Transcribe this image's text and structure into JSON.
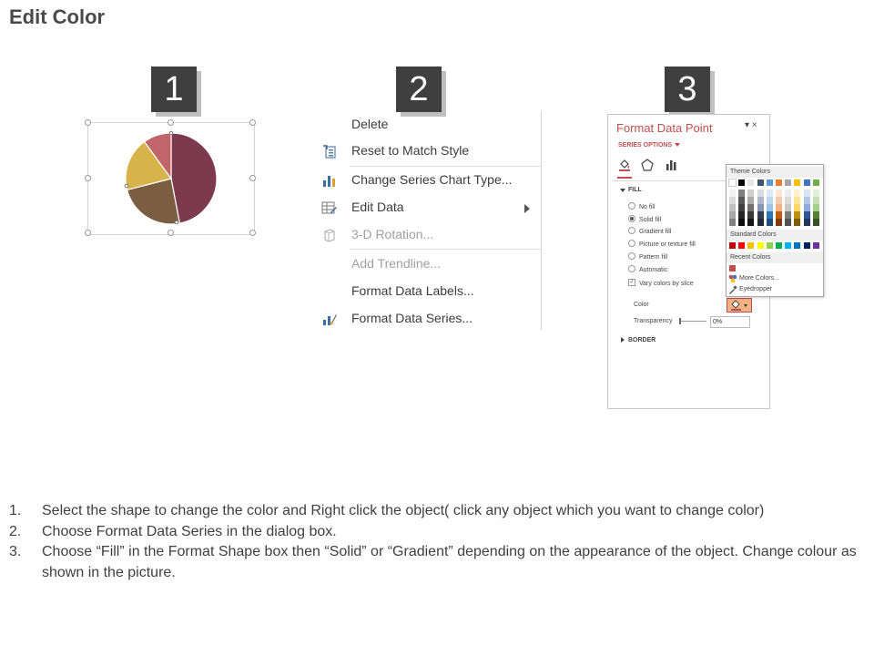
{
  "title": "Edit Color",
  "badges": [
    "1",
    "2",
    "3"
  ],
  "pie": {
    "slices": [
      {
        "color": "#7d3a4f",
        "value": 47
      },
      {
        "color": "#7b5e42",
        "value": 24
      },
      {
        "color": "#d8b24a",
        "value": 19
      },
      {
        "color": "#c0666b",
        "value": 10
      }
    ]
  },
  "context_menu": {
    "items": [
      {
        "label": "Delete",
        "icon": "none",
        "disabled": false
      },
      {
        "label": "Reset to Match Style",
        "icon": "reset-style-icon",
        "disabled": false
      },
      {
        "label": "Change Series Chart Type...",
        "icon": "chart-type-icon",
        "disabled": false
      },
      {
        "label": "Edit Data",
        "icon": "edit-data-icon",
        "disabled": false,
        "submenu": true
      },
      {
        "label": "3-D Rotation...",
        "icon": "rotation-icon",
        "disabled": true
      },
      {
        "label": "Add Trendline...",
        "icon": "none",
        "disabled": true
      },
      {
        "label": "Format Data Labels...",
        "icon": "none",
        "disabled": false
      },
      {
        "label": "Format Data Series...",
        "icon": "format-series-icon",
        "disabled": false
      }
    ]
  },
  "format_pane": {
    "title": "Format Data Point",
    "controls": "▾ ×",
    "series_options": "SERIES OPTIONS",
    "fill_header": "FILL",
    "fill_options": [
      {
        "label": "No fill",
        "type": "radio",
        "checked": false
      },
      {
        "label": "Solid fill",
        "type": "radio",
        "checked": true
      },
      {
        "label": "Gradient fill",
        "type": "radio",
        "checked": false
      },
      {
        "label": "Picture or texture fill",
        "type": "radio",
        "checked": false
      },
      {
        "label": "Pattern fill",
        "type": "radio",
        "checked": false
      },
      {
        "label": "Automatic",
        "type": "radio",
        "checked": false
      },
      {
        "label": "Vary colors by slice",
        "type": "checkbox",
        "checked": true
      }
    ],
    "color_label": "Color",
    "transparency_label": "Transparency",
    "transparency_value": "0%",
    "border_header": "BORDER"
  },
  "color_popup": {
    "theme_header": "Theme Colors",
    "standard_header": "Standard Colors",
    "recent_header": "Recent Colors",
    "more_colors": "More Colors...",
    "eyedropper": "Eyedropper",
    "theme_top": [
      "#ffffff",
      "#000000",
      "#e7e6e6",
      "#44546a",
      "#5b9bd5",
      "#ed7d31",
      "#a5a5a5",
      "#ffc000",
      "#4472c4",
      "#70ad47"
    ],
    "theme_columns": [
      [
        "#f2f2f2",
        "#d9d9d9",
        "#bfbfbf",
        "#a6a6a6",
        "#808080"
      ],
      [
        "#7f7f7f",
        "#595959",
        "#404040",
        "#262626",
        "#0d0d0d"
      ],
      [
        "#d0cece",
        "#aeaaaa",
        "#757171",
        "#3a3838",
        "#171616"
      ],
      [
        "#d6dce4",
        "#adb9ca",
        "#8496b0",
        "#333f4f",
        "#222a35"
      ],
      [
        "#deebf6",
        "#bdd7ee",
        "#9dc3e6",
        "#2e75b5",
        "#1f4e79"
      ],
      [
        "#fbe5d5",
        "#f7cbac",
        "#f4b183",
        "#c55a11",
        "#843c0c"
      ],
      [
        "#ededed",
        "#dbdbdb",
        "#c9c9c9",
        "#7b7b7b",
        "#525252"
      ],
      [
        "#fff2cc",
        "#ffe599",
        "#ffd966",
        "#bf9000",
        "#7f6000"
      ],
      [
        "#dae3f3",
        "#b4c7e7",
        "#8faadc",
        "#2f5496",
        "#1f3864"
      ],
      [
        "#e2efd9",
        "#c5e0b3",
        "#a8d08d",
        "#538135",
        "#375623"
      ]
    ],
    "standard": [
      "#c00000",
      "#ff0000",
      "#ffc000",
      "#ffff00",
      "#92d050",
      "#00b050",
      "#00b0f0",
      "#0070c0",
      "#002060",
      "#7030a0"
    ],
    "recent": [
      "#c0504d"
    ]
  },
  "instructions": [
    {
      "num": "1.",
      "text": "Select the shape to change the color and Right click the object( click any object which you want to change color)"
    },
    {
      "num": "2.",
      "text": "Choose Format Data Series in the dialog box."
    },
    {
      "num": "3.",
      "text": "Choose “Fill” in the Format Shape box then “Solid” or “Gradient” depending on the appearance of the object. Change colour as shown in the picture."
    }
  ]
}
